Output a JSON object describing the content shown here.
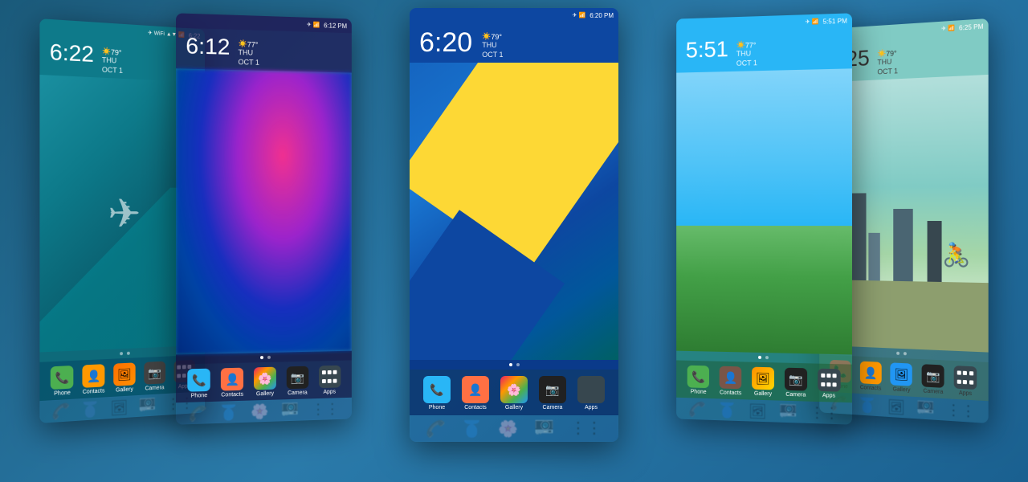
{
  "scene": {
    "bg_color": "#2a6a8a"
  },
  "phones": [
    {
      "id": "phone-1",
      "position": "far-left",
      "time": "6:22",
      "day": "THU",
      "date": "OCT 1",
      "temp": "79°",
      "status_time": "6:22",
      "wallpaper": "teal-geo",
      "apps": [
        "Phone",
        "Contacts",
        "Gallery",
        "Camera",
        "Apps"
      ],
      "dots": [
        false,
        false
      ],
      "z": 1
    },
    {
      "id": "phone-2",
      "position": "left",
      "time": "6:12",
      "day": "THU",
      "date": "OCT 1",
      "temp": "77°",
      "status_time": "6:12 PM",
      "wallpaper": "blurry-colorful",
      "apps": [
        "Phone",
        "Contacts",
        "Gallery",
        "Camera",
        "Apps"
      ],
      "dots": [
        true,
        false
      ],
      "z": 2
    },
    {
      "id": "phone-3",
      "position": "center",
      "time": "6:20",
      "day": "THU",
      "date": "OCT 1",
      "temp": "79°",
      "status_time": "6:20 PM",
      "wallpaper": "material-blue-yellow",
      "apps": [
        "Phone",
        "Contacts",
        "Gallery",
        "Camera",
        "Apps"
      ],
      "dots": [
        true,
        false
      ],
      "z": 5
    },
    {
      "id": "phone-4",
      "position": "right",
      "time": "5:51",
      "day": "THU",
      "date": "OCT 1",
      "temp": "77°",
      "status_time": "5:51 PM",
      "wallpaper": "grass-sky",
      "apps": [
        "Phone",
        "Contacts",
        "Gallery",
        "Camera",
        "Apps"
      ],
      "dots": [
        true,
        false
      ],
      "z": 2
    },
    {
      "id": "phone-5",
      "position": "far-right",
      "time": "6:25",
      "day": "THU",
      "date": "OCT 1",
      "temp": "79°",
      "status_time": "6:25 PM",
      "wallpaper": "city-cyclist",
      "apps": [
        "Phone",
        "Contacts",
        "Gallery",
        "Camera",
        "Apps"
      ],
      "dots": [
        false,
        false
      ],
      "z": 1
    }
  ],
  "dock_apps": {
    "phone": {
      "label": "Phone",
      "color": "#4caf50"
    },
    "contacts": {
      "label": "Contacts",
      "color": "#ff9800"
    },
    "gallery": {
      "label": "Gallery",
      "color": "#ff6f00"
    },
    "camera": {
      "label": "Camera",
      "color": "#424242"
    },
    "apps": {
      "label": "Apps",
      "color": "#37474f"
    }
  }
}
